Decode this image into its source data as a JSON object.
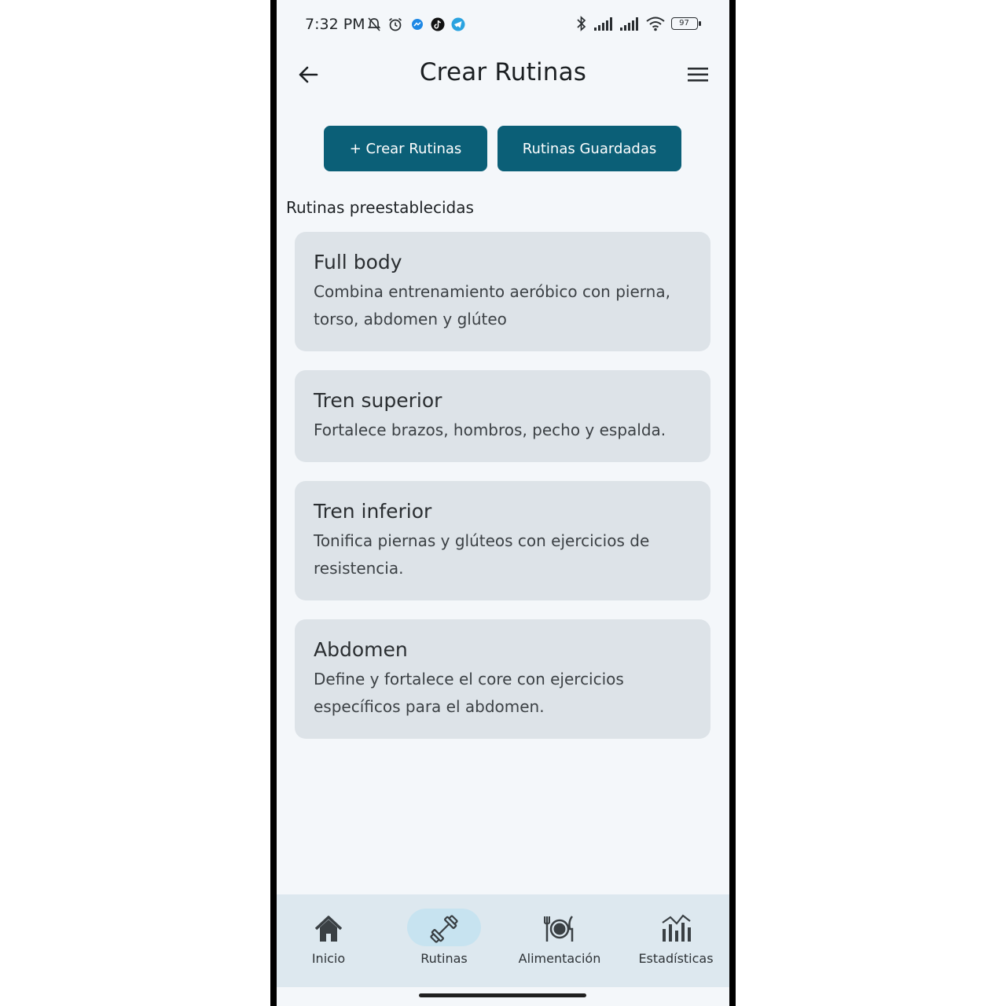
{
  "status_bar": {
    "time": "7:32 PM",
    "battery": "97"
  },
  "app_bar": {
    "title": "Crear Rutinas"
  },
  "actions": {
    "create_label": "+ Crear Rutinas",
    "saved_label": "Rutinas Guardadas"
  },
  "section_title": "Rutinas preestablecidas",
  "routines": [
    {
      "title": "Full body",
      "desc_line1": "Combina entrenamiento aeróbico con pierna,",
      "desc_line2": "torso, abdomen y glúteo"
    },
    {
      "title": "Tren superior",
      "desc_line1": "Fortalece brazos, hombros, pecho y espalda."
    },
    {
      "title": "Tren inferior",
      "desc_line1": "Tonifica piernas y glúteos con ejercicios de",
      "desc_line2": "resistencia."
    },
    {
      "title": "Abdomen",
      "desc_line1": "Define y fortalece el core con ejercicios",
      "desc_line2": "específicos para el abdomen."
    }
  ],
  "bottom_nav": [
    {
      "label": "Inicio",
      "icon": "home-icon",
      "selected": false
    },
    {
      "label": "Rutinas",
      "icon": "dumbbell-icon",
      "selected": true
    },
    {
      "label": "Alimentación",
      "icon": "plate-cutlery-icon",
      "selected": false
    },
    {
      "label": "Estadísticas",
      "icon": "stats-icon",
      "selected": false
    }
  ],
  "colors": {
    "primary": "#0b5f77",
    "card": "#dde3e8",
    "nav_bg": "#dde8ef",
    "nav_selected": "#c7e3f0",
    "background": "#f4f7fa"
  }
}
